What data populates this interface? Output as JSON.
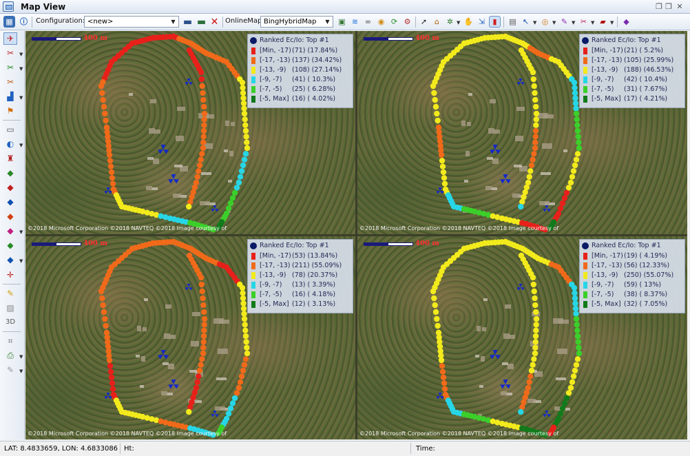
{
  "window": {
    "title": "Map View"
  },
  "toolbar": {
    "configuration_label": "Configuration:",
    "configuration_value": "<new>",
    "onlinemap_label": "OnlineMap:",
    "onlinemap_value": "BingHybridMap"
  },
  "colors": {
    "red": "#e8201a",
    "orange": "#f06a1a",
    "yellow": "#f2ea1c",
    "cyan": "#27d6e6",
    "green": "#3ccf2a",
    "darkgreen": "#127a1a"
  },
  "panels": [
    {
      "scale_label": "400 m",
      "copyright": "©2018 Microsoft Corporation  ©2018 NAVTEQ  ©2018 Image courtesy of",
      "legend": {
        "title": "Ranked Ec/Io: Top #1",
        "rows": [
          {
            "range": "[Min, -17)",
            "count": "(71) (17.84%)"
          },
          {
            "range": "[-17, -13)",
            "count": "(137) (34.42%)"
          },
          {
            "range": "[-13, -9)",
            "count": "(108) (27.14%)"
          },
          {
            "range": "[-9, -7)",
            "count": "(41) ( 10.3%)"
          },
          {
            "range": "[-7, -5)",
            "count": "(25) ( 6.28%)"
          },
          {
            "range": "[-5, Max]",
            "count": "(16) ( 4.02%)"
          }
        ]
      }
    },
    {
      "scale_label": "400 m",
      "copyright": "©2018 Microsoft Corporation  ©2018 NAVTEQ  ©2018 Image courtesy of",
      "legend": {
        "title": "Ranked Ec/Io: Top #1",
        "rows": [
          {
            "range": "[Min, -17)",
            "count": "(21) ( 5.2%)"
          },
          {
            "range": "[-17, -13)",
            "count": "(105) (25.99%)"
          },
          {
            "range": "[-13, -9)",
            "count": "(188) (46.53%)"
          },
          {
            "range": "[-9, -7)",
            "count": "(42) ( 10.4%)"
          },
          {
            "range": "[-7, -5)",
            "count": "(31) ( 7.67%)"
          },
          {
            "range": "[-5, Max]",
            "count": "(17) ( 4.21%)"
          }
        ]
      }
    },
    {
      "scale_label": "400 m",
      "copyright": "©2018 Microsoft Corporation  ©2018 NAVTEQ  ©2018 Image courtesy of",
      "legend": {
        "title": "Ranked Ec/Io: Top #1",
        "rows": [
          {
            "range": "[Min, -17)",
            "count": "(53) (13.84%)"
          },
          {
            "range": "[-17, -13)",
            "count": "(211) (55.09%)"
          },
          {
            "range": "[-13, -9)",
            "count": "(78) (20.37%)"
          },
          {
            "range": "[-9, -7)",
            "count": "(13) ( 3.39%)"
          },
          {
            "range": "[-7, -5)",
            "count": "(16) ( 4.18%)"
          },
          {
            "range": "[-5, Max]",
            "count": "(12) ( 3.13%)"
          }
        ]
      }
    },
    {
      "scale_label": "400 m",
      "copyright": "©2018 Microsoft Corporation  ©2018 NAVTEQ  ©2018 Image courtesy of",
      "legend": {
        "title": "Ranked Ec/Io: Top #1",
        "rows": [
          {
            "range": "[Min, -17)",
            "count": "(19) ( 4.19%)"
          },
          {
            "range": "[-17, -13)",
            "count": "(56) (12.33%)"
          },
          {
            "range": "[-13, -9)",
            "count": "(250) (55.07%)"
          },
          {
            "range": "[-9, -7)",
            "count": "(59) ( 13%)"
          },
          {
            "range": "[-7, -5)",
            "count": "(38) ( 8.37%)"
          },
          {
            "range": "[-5, Max]",
            "count": "(32) ( 7.05%)"
          }
        ]
      }
    }
  ],
  "statusbar": {
    "latlon": "LAT: 8.4833659, LON: 4.6833086",
    "ht": "Ht:",
    "time": "Time:"
  }
}
